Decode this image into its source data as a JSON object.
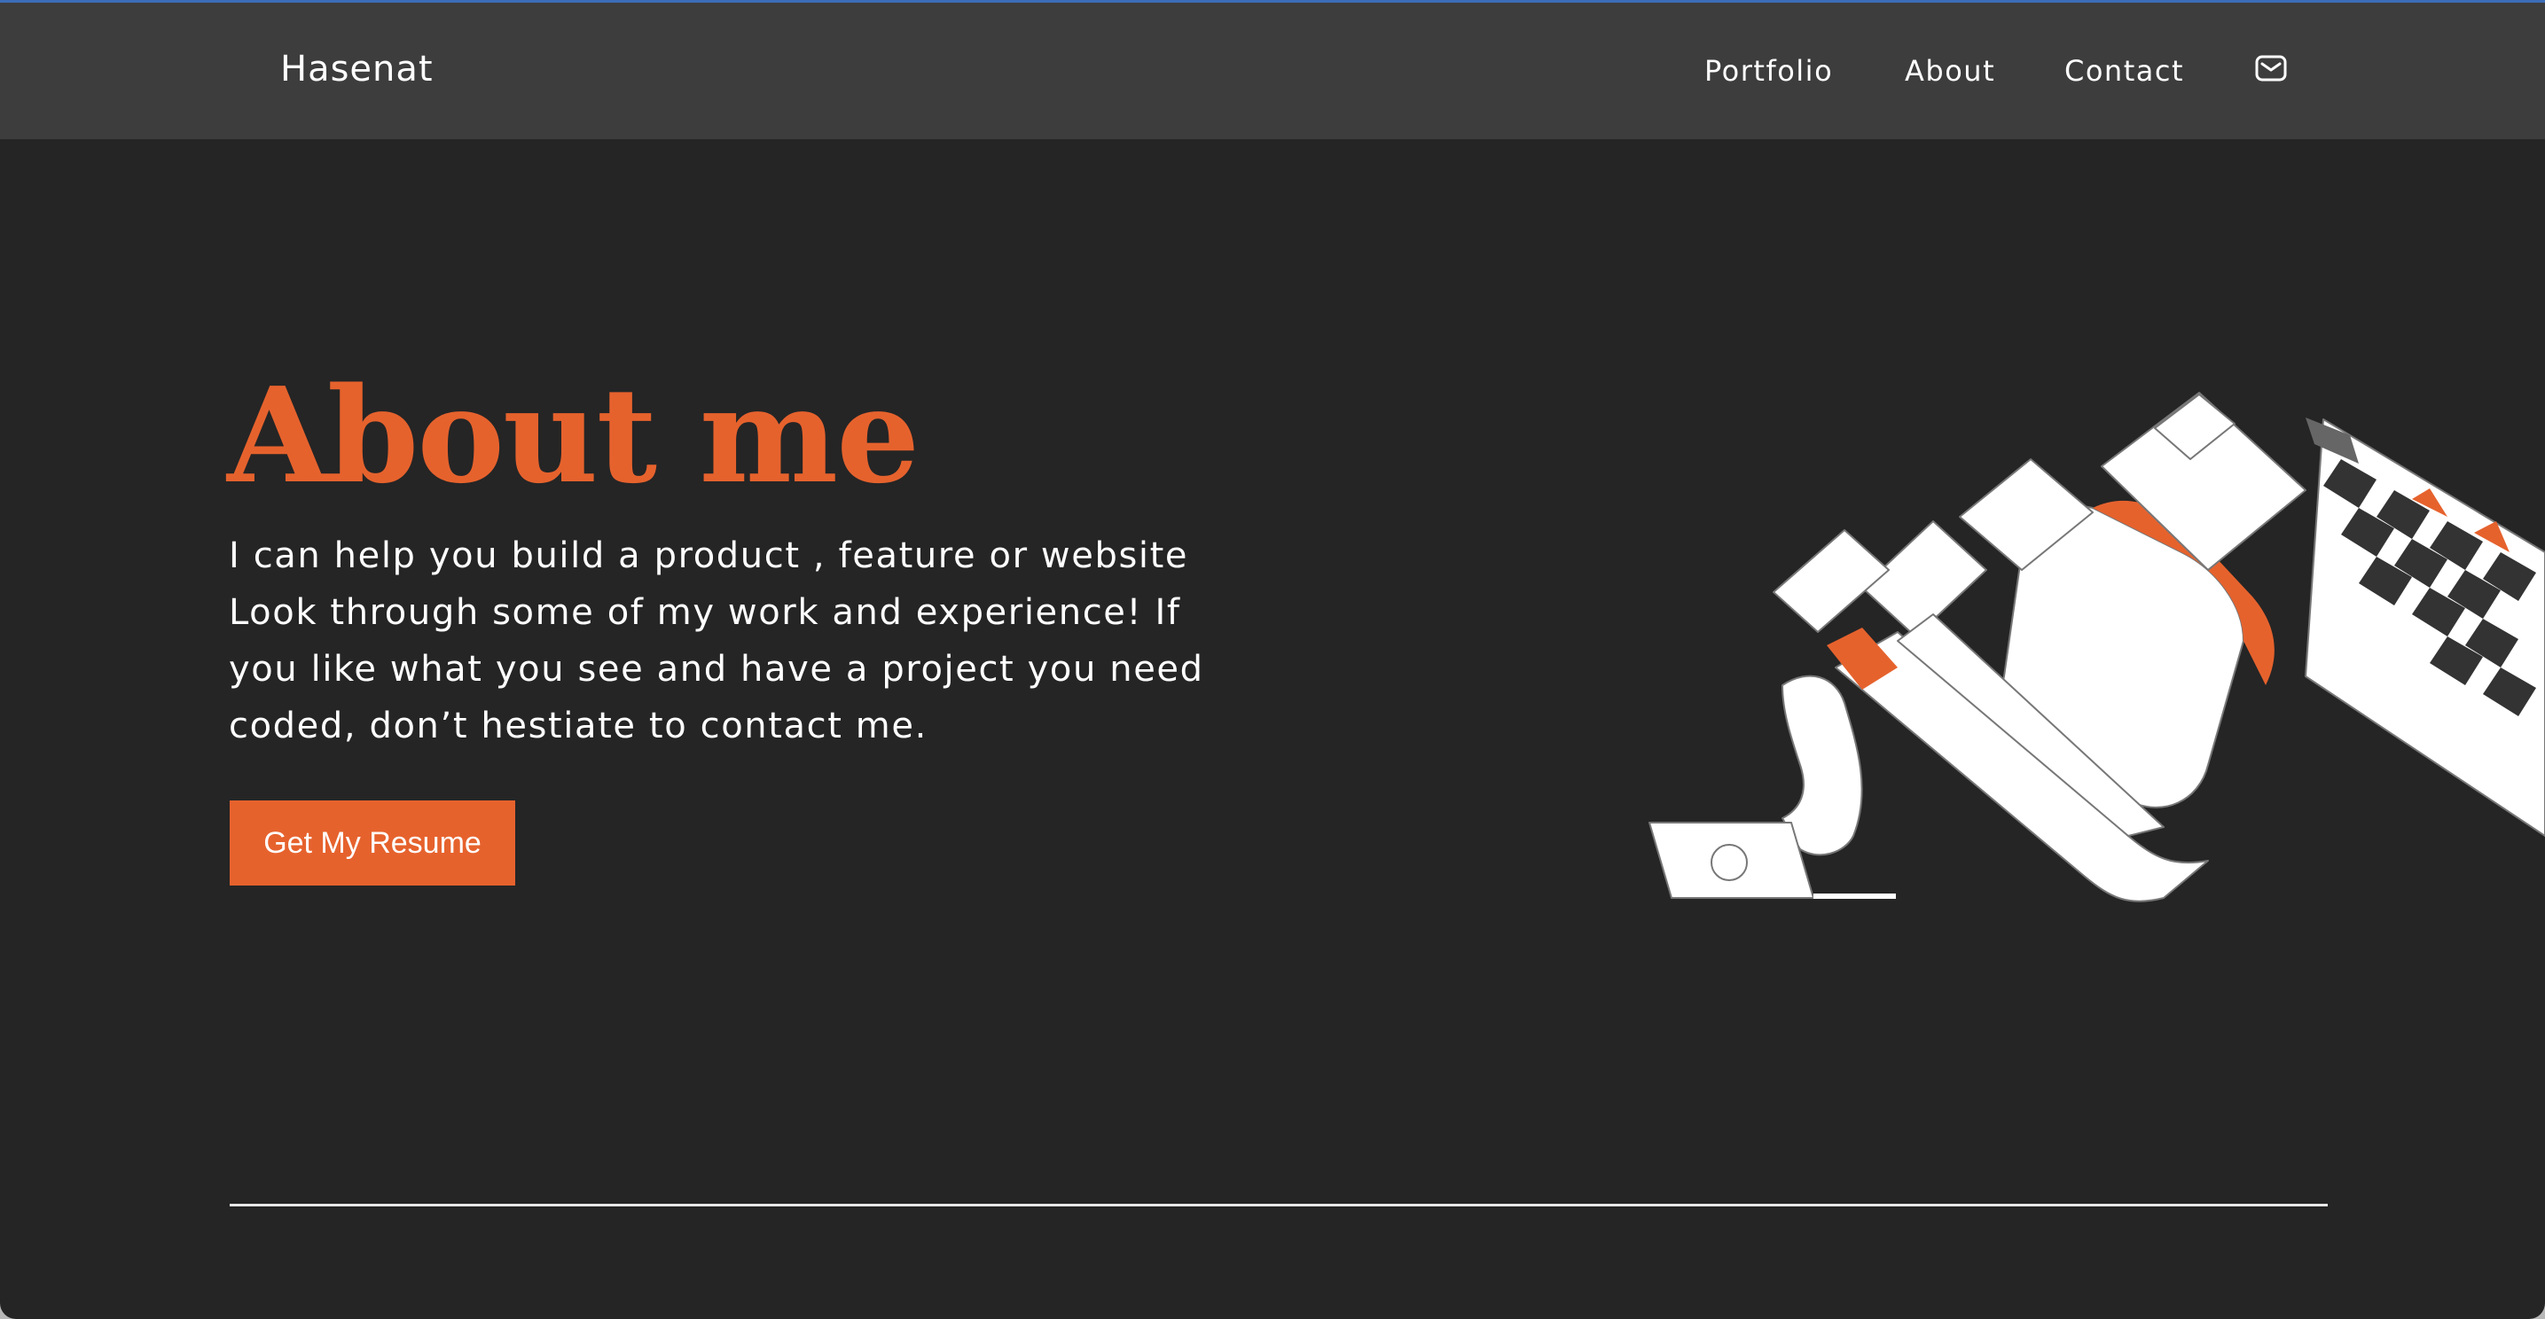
{
  "navbar": {
    "brand": "Hasenat",
    "links": [
      {
        "label": "Portfolio"
      },
      {
        "label": "About"
      },
      {
        "label": "Contact"
      }
    ],
    "mail_icon": "mail-icon"
  },
  "hero": {
    "title": "About me",
    "text_lines": [
      "I can help you build a product , feature or website",
      "Look through some of my work and experience! If",
      "you like what you see and have a project you need",
      "coded, don’t hestiate to contact me."
    ],
    "button_label": "Get My Resume",
    "illustration": "abstract-checkered-illustration"
  },
  "colors": {
    "accent": "#e6622d",
    "background": "#252525",
    "navbar": "#3e3d3e",
    "text": "#ffffff"
  }
}
